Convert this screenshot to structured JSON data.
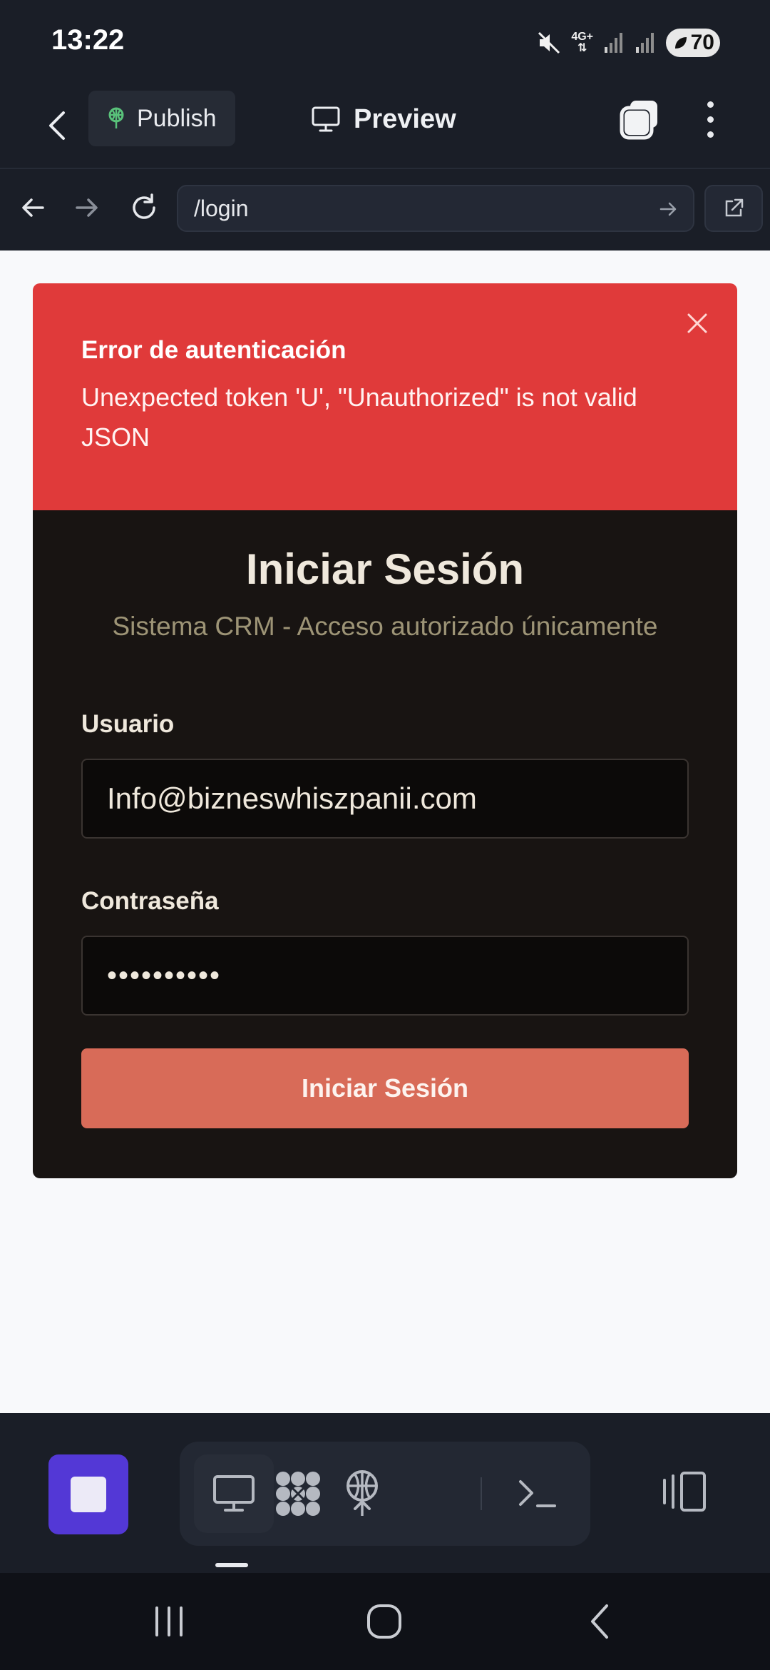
{
  "status": {
    "time": "13:22",
    "network": "4G+",
    "battery": "70"
  },
  "app_bar": {
    "publish_label": "Publish",
    "preview_label": "Preview"
  },
  "browser": {
    "url": "/login"
  },
  "alert": {
    "title": "Error de autenticación",
    "message": "Unexpected token 'U', \"Unauthorized\" is not valid JSON"
  },
  "login": {
    "title": "Iniciar Sesión",
    "subtitle": "Sistema CRM - Acceso autorizado únicamente",
    "username_label": "Usuario",
    "username_value": "Info@bizneswhiszpanii.com",
    "password_label": "Contraseña",
    "password_value": "••••••••••",
    "submit_label": "Iniciar Sesión"
  },
  "toolbar": {
    "tools": [
      "preview-icon",
      "apps-icon",
      "deploy-icon",
      "terminal-icon"
    ],
    "active_tool": "preview-icon"
  },
  "colors": {
    "alert_bg": "#e03a3a",
    "card_bg": "#181412",
    "submit_bg": "#d86b58",
    "stop_bg": "#5338d6"
  }
}
